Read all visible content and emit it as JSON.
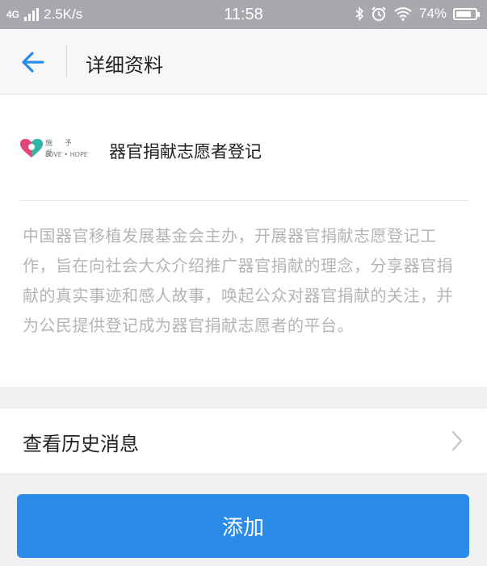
{
  "status_bar": {
    "network": "4G",
    "speed": "2.5K/s",
    "time": "11:58",
    "battery": "74%",
    "icons": [
      "bluetooth-icon",
      "alarm-icon",
      "wifi-icon",
      "battery-icon"
    ]
  },
  "nav": {
    "title": "详细资料",
    "back_icon": "arrow-left-icon"
  },
  "account": {
    "name": "器官捐献志愿者登记",
    "logo_text": "施 予 爱",
    "logo_subtext": "LOVE • HOPE",
    "description": "中国器官移植发展基金会主办，开展器官捐献志愿登记工作，旨在向社会大众介绍推广器官捐献的理念，分享器官捐献的真实事迹和感人故事，唤起公众对器官捐献的关注，并为公民提供登记成为器官捐献志愿者的平台。"
  },
  "history": {
    "label": "查看历史消息"
  },
  "actions": {
    "add_label": "添加"
  },
  "colors": {
    "accent": "#2a8ce8",
    "status_bar": "#a8a8ad",
    "description_text": "#b5b5b8",
    "logo_pink": "#e0457b",
    "logo_teal": "#2bb8a8"
  }
}
